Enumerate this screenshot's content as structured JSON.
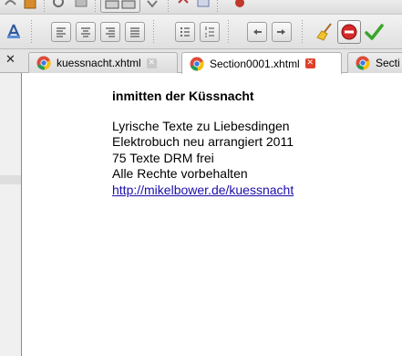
{
  "tabs": [
    {
      "label": "kuessnacht.xhtml",
      "active": false
    },
    {
      "label": "Section0001.xhtml",
      "active": true
    },
    {
      "label": "Secti",
      "active": false
    }
  ],
  "document": {
    "title": "inmitten der Küssnacht",
    "lines": [
      "Lyrische Texte zu Liebesdingen",
      "Elektrobuch neu arrangiert 2011",
      "75 Texte DRM frei",
      "Alle Rechte vorbehalten"
    ],
    "link": "http://mikelbower.de/kuessnacht"
  },
  "icons": {
    "toolbar": [
      "style-icon",
      "align-left-icon",
      "align-center-icon",
      "align-right-icon",
      "justify-icon",
      "bullet-list-icon",
      "numbered-list-icon",
      "decrease-indent-icon",
      "increase-indent-icon",
      "cleanup-broom-icon",
      "stop-icon",
      "validate-check-icon"
    ],
    "tab": "chrome-icon"
  },
  "colors": {
    "link": "#1a0dab",
    "close_active": "#e0402c",
    "validate": "#3aa52a"
  }
}
